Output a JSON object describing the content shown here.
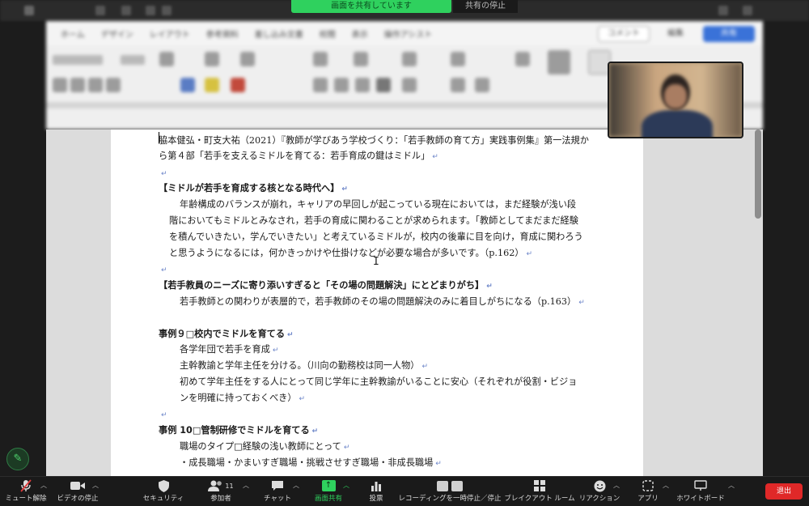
{
  "share": {
    "banner_text": "画面を共有しています",
    "stop_text": "共有の停止"
  },
  "ribbon": {
    "tabs": [
      "ホーム",
      "デザイン",
      "レイアウト",
      "参考資料",
      "差し込み文書",
      "校閲",
      "表示",
      "操作アシスト"
    ],
    "comment_label": "コメント",
    "edit_label": "編集",
    "share_label": "共有"
  },
  "document": {
    "lines": [
      {
        "text": "脇本健弘・町支大祐（2021）『教師が学びあう学校づくり：「若手教師の育て方」実践事例集』第一法規か",
        "style": "plain",
        "mark": false
      },
      {
        "text": "ら第４部「若手を支えるミドルを育てる：若手育成の鍵はミドル」",
        "style": "plain",
        "mark": true
      },
      {
        "text": "",
        "style": "plain",
        "mark": true
      },
      {
        "text": "【ミドルが若手を育成する核となる時代へ】",
        "style": "bold",
        "mark": true
      },
      {
        "text": "年齢構成のバランスが崩れ，キャリアの早回しが起こっている現在においては，まだ経験が浅い段",
        "style": "indent",
        "mark": false
      },
      {
        "text": "階においてもミドルとみなされ，若手の育成に関わることが求められます。「教師としてまだまだ経験",
        "style": "indent2",
        "mark": false
      },
      {
        "text": "を積んでいきたい，学んでいきたい」と考えているミドルが，校内の後輩に目を向け，育成に関わろう",
        "style": "indent2",
        "mark": false
      },
      {
        "text": "と思うようになるには，何かきっかけや仕掛けなどが必要な場合が多いです。（p.162）",
        "style": "indent2",
        "mark": true
      },
      {
        "text": "",
        "style": "plain",
        "mark": true
      },
      {
        "text": "【若手教員のニーズに寄り添いすぎると「その場の問題解決」にとどまりがち】",
        "style": "bold",
        "mark": true
      },
      {
        "text": "若手教師との関わりが表層的で，若手教師のその場の問題解決のみに着目しがちになる（p.163）",
        "style": "indent",
        "mark": true
      },
      {
        "text": "",
        "style": "plain",
        "mark": false
      },
      {
        "text": "事例９□校内でミドルを育てる",
        "style": "bold",
        "mark": true
      },
      {
        "text": "各学年団で若手を育成",
        "style": "indent",
        "mark": true
      },
      {
        "text": "主幹教諭と学年主任を分ける。（川向の勤務校は同一人物）",
        "style": "indent",
        "mark": true
      },
      {
        "text": "初めて学年主任をする人にとって同じ学年に主幹教諭がいることに安心（それぞれが役割・ビジョ",
        "style": "indent",
        "mark": false
      },
      {
        "text": "ンを明確に持っておくべき）",
        "style": "indent",
        "mark": true
      },
      {
        "text": "",
        "style": "plain",
        "mark": true
      },
      {
        "text": "事例 10□管制研修でミドルを育てる",
        "style": "bold",
        "mark": true
      },
      {
        "text": "職場のタイプ□経験の浅い教師にとって",
        "style": "indent",
        "mark": true
      },
      {
        "text": "・成長職場・かまいすぎ職場・挑戦させすぎ職場・非成長職場",
        "style": "indent",
        "mark": true
      }
    ]
  },
  "toolbar": {
    "items": [
      {
        "name": "mute",
        "label": "ミュート解除",
        "icon": "mic-off-icon",
        "caret": true
      },
      {
        "name": "video",
        "label": "ビデオの停止",
        "icon": "video-icon",
        "caret": true
      },
      {
        "name": "security",
        "label": "セキュリティ",
        "icon": "shield-icon",
        "caret": false
      },
      {
        "name": "participants",
        "label": "参加者",
        "icon": "participants-icon",
        "caret": true,
        "badge": "11"
      },
      {
        "name": "chat",
        "label": "チャット",
        "icon": "chat-icon",
        "caret": true
      },
      {
        "name": "share",
        "label": "画面共有",
        "icon": "share-screen-icon",
        "caret": true
      },
      {
        "name": "poll",
        "label": "投票",
        "icon": "poll-icon",
        "caret": false
      },
      {
        "name": "recording",
        "label": "レコーディングを一時停止／停止",
        "icon": "recording-icon",
        "caret": false
      },
      {
        "name": "breakout",
        "label": "ブレイクアウト ルーム",
        "icon": "breakout-icon",
        "caret": false
      },
      {
        "name": "reaction",
        "label": "リアクション",
        "icon": "reaction-icon",
        "caret": true
      },
      {
        "name": "apps",
        "label": "アプリ",
        "icon": "apps-icon",
        "caret": true
      },
      {
        "name": "whiteboard",
        "label": "ホワイトボード",
        "icon": "whiteboard-icon",
        "caret": true
      }
    ],
    "leave_label": "退出"
  },
  "colors": {
    "share_green": "#2fd15e",
    "leave_red": "#e02828",
    "toolbar_bg": "#1a1a1a"
  }
}
